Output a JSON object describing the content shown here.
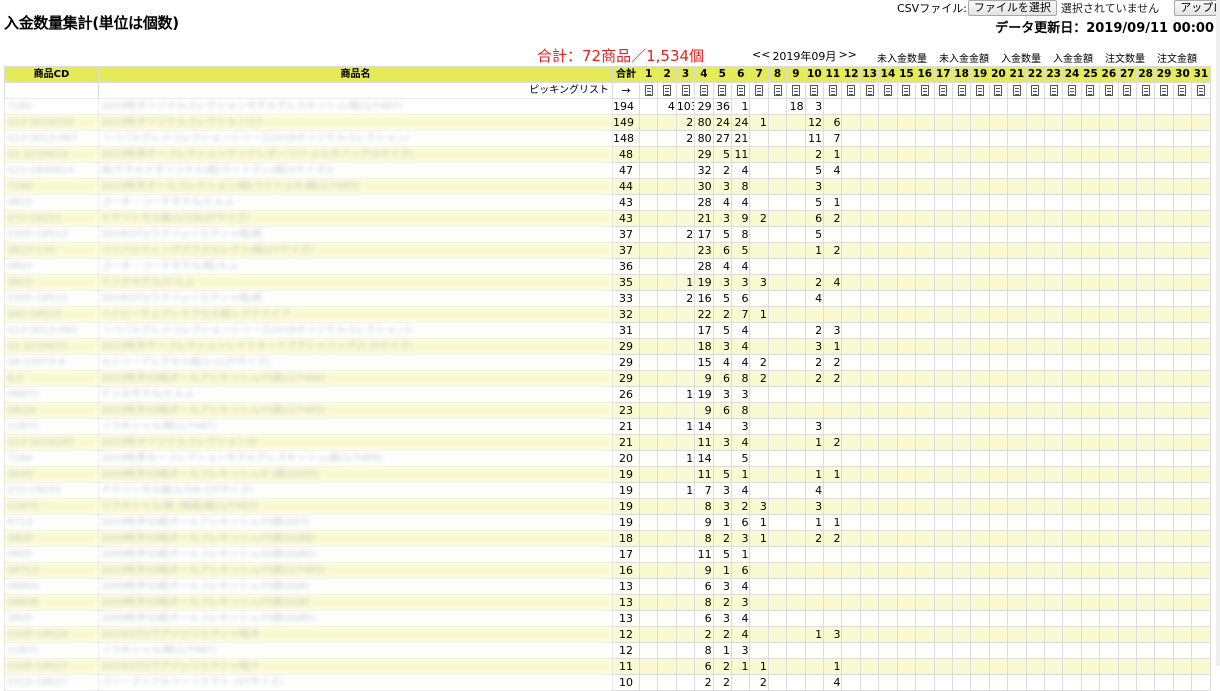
{
  "page": {
    "title": "入金数量集計(単位は個数)",
    "csv_label": "CSVファイル:",
    "choose_file_label": "ファイルを選択",
    "no_file_label": "選択されていません",
    "upload_label": "アップロード",
    "updated_label": "データ更新日：2019/09/11 00:00",
    "total_label": "合計：72商品／1,534個",
    "month_prev": "<<",
    "month_label": "2019年09月",
    "month_next": ">>",
    "view_links": [
      "未入金数量",
      "未入金金額",
      "入金数量",
      "入金金額",
      "注文数量",
      "注文金額"
    ]
  },
  "table": {
    "headers": {
      "cd": "商品CD",
      "name": "商品名",
      "sum": "合計"
    },
    "days": [
      "1",
      "2",
      "3",
      "4",
      "5",
      "6",
      "7",
      "8",
      "9",
      "10",
      "11",
      "12",
      "13",
      "14",
      "15",
      "16",
      "17",
      "18",
      "19",
      "20",
      "21",
      "22",
      "23",
      "24",
      "25",
      "26",
      "27",
      "28",
      "29",
      "30",
      "31"
    ],
    "picking_label": "ピッキングリスト",
    "picking_arrow": "→",
    "rows": [
      {
        "cd": "7182",
        "name": "2019秋オリジナルコレクションモデルグレスキッシュ/紙(1/7487)",
        "total": "194",
        "v": {
          "1": "4",
          "2": "103",
          "3": "29",
          "4": "36",
          "5": "1",
          "8": "18",
          "9": "3"
        }
      },
      {
        "cd": "S13-3014155",
        "name": "2019秋オリジナルコレクション/13",
        "total": "149",
        "v": {
          "2": "2",
          "3": "80",
          "4": "24",
          "5": "24",
          "6": "1",
          "9": "12",
          "10": "6"
        }
      },
      {
        "cd": "S13-3013-067",
        "name": "リババルグレスコレクションシリーズ2019オリジナルコレクション/",
        "total": "148",
        "v": {
          "2": "2",
          "3": "80",
          "4": "27",
          "5": "21",
          "9": "11",
          "10": "7"
        }
      },
      {
        "cd": "S1-3219414",
        "name": "2019秋季オーコレクションサックレポーツ/ショルダバッグ(Sサイズ)",
        "total": "48",
        "v": {
          "3": "29",
          "4": "5",
          "5": "11",
          "9": "2",
          "10": "1"
        }
      },
      {
        "cd": "S21-1840614",
        "name": "あ/ナチルドオリジナル/紙/ライトグレ(紙(Sサイズ))",
        "total": "47",
        "v": {
          "3": "32",
          "4": "2",
          "5": "4",
          "9": "5",
          "10": "4"
        }
      },
      {
        "cd": "7180",
        "name": "2019秋冬オールコレクション/紙(ライトふキ/紙(1/7485)",
        "total": "44",
        "v": {
          "3": "30",
          "4": "3",
          "5": "8",
          "9": "3"
        }
      },
      {
        "cd": "9815",
        "name": "ゴーホ・コーチモデル/ビルふ",
        "total": "43",
        "v": {
          "3": "28",
          "4": "4",
          "5": "4",
          "9": "5",
          "10": "1"
        }
      },
      {
        "cd": "272-19251",
        "name": "ナチリシモル紙/1/7/8(2Tサイズ)",
        "total": "43",
        "v": {
          "3": "21",
          "4": "3",
          "5": "9",
          "6": "2",
          "9": "6",
          "10": "2"
        }
      },
      {
        "cd": "2305-18513",
        "name": "2019(2T)/ラグジュリエクシャ紙/紙",
        "total": "37",
        "v": {
          "2": "2",
          "3": "17",
          "4": "5",
          "5": "8",
          "9": "5"
        }
      },
      {
        "cd": "9823-130",
        "name": "パリパルティンググラスセレクト/紙(2Tサイズ)",
        "total": "37",
        "v": {
          "3": "23",
          "4": "6",
          "5": "5",
          "9": "1",
          "10": "2"
        }
      },
      {
        "cd": "0803",
        "name": "ゴーホ・コーチモデル/紙/ルふ",
        "total": "36",
        "v": {
          "3": "28",
          "4": "4",
          "5": "4"
        }
      },
      {
        "cd": "9815",
        "name": "テジカモデル/ビルふ",
        "total": "35",
        "v": {
          "2": "1",
          "3": "19",
          "4": "3",
          "5": "3",
          "6": "3",
          "9": "2",
          "10": "4"
        }
      },
      {
        "cd": "2305-18515",
        "name": "2019(2T)/ラグジュリエクシャ紙/紙",
        "total": "33",
        "v": {
          "2": "2",
          "3": "16",
          "4": "5",
          "5": "6",
          "9": "4"
        }
      },
      {
        "cd": "S92-18515",
        "name": "ハイピーチェアレテクセル紙レグテクイア",
        "total": "32",
        "v": {
          "3": "22",
          "4": "2",
          "5": "7",
          "6": "1"
        }
      },
      {
        "cd": "S13-3013-062",
        "name": "リババルグレスコレクションシリーズ2019オリジナルコレクション2",
        "total": "31",
        "v": {
          "3": "17",
          "4": "5",
          "5": "4",
          "9": "2",
          "10": "3"
        }
      },
      {
        "cd": "S1-3219415",
        "name": "2019秋冬サーコレクションレイトキットアクシャバッグ/2 (Sサイズ)",
        "total": "29",
        "v": {
          "3": "18",
          "4": "3",
          "5": "4",
          "9": "3",
          "10": "1"
        }
      },
      {
        "cd": "S8-13573-4",
        "name": "ルシリーアレクセル紙/1-2(2Tサイズ)",
        "total": "29",
        "v": {
          "3": "15",
          "4": "4",
          "5": "4",
          "6": "2",
          "9": "2",
          "10": "2"
        }
      },
      {
        "cd": "8.8",
        "name": "2019秋冬SS紙オールアレキッシュ/7(紙(1/7486)",
        "total": "29",
        "v": {
          "3": "9",
          "4": "6",
          "5": "8",
          "6": "2",
          "9": "2",
          "10": "2"
        }
      },
      {
        "cd": "09873",
        "name": "テジカモデル/ビルふ",
        "total": "26",
        "v": {
          "2": "1",
          "3": "19",
          "4": "3",
          "5": "3"
        }
      },
      {
        "cd": "08/16",
        "name": "2019秋冬SS紙オールアレキッシュ/7(紙(1/7485)",
        "total": "23",
        "v": {
          "3": "9",
          "4": "6",
          "5": "8"
        }
      },
      {
        "cd": "11872",
        "name": "ジラキシャル/紙(1/7487)",
        "total": "21",
        "v": {
          "2": "1",
          "3": "14",
          "5": "3",
          "9": "3"
        }
      },
      {
        "cd": "S13-3014185",
        "name": "2019秋オリジナルコレクション/8",
        "total": "21",
        "v": {
          "3": "11",
          "4": "3",
          "5": "4",
          "9": "1",
          "10": "2"
        }
      },
      {
        "cd": "7184",
        "name": "2019秋季モーコレクションモデルグレスキッシュ/紙(1/7489)",
        "total": "20",
        "v": {
          "2": "1",
          "3": "14",
          "5": "5"
        }
      },
      {
        "cd": "3845",
        "name": "2009秋冬SS紙オールコレキッシュ/2 (紙(SS85)",
        "total": "19",
        "v": {
          "3": "11",
          "4": "5",
          "5": "1",
          "9": "1",
          "10": "1"
        }
      },
      {
        "cd": "272-19255",
        "name": "ナチリシモル紙/1/7/8 (2Tサイズ)",
        "total": "19",
        "v": {
          "2": "1",
          "3": "7",
          "4": "3",
          "5": "4",
          "9": "4"
        }
      },
      {
        "cd": "11875",
        "name": "ジラキシャル/紙 (紙紙/紙(1/7487)",
        "total": "19",
        "v": {
          "3": "8",
          "4": "3",
          "5": "2",
          "6": "3",
          "9": "3"
        }
      },
      {
        "cd": "8713",
        "name": "2019秋冬SS紙オールアレキッシュ/7(紙(SS7)",
        "total": "19",
        "v": {
          "3": "9",
          "4": "1",
          "5": "6",
          "6": "1",
          "9": "1",
          "10": "1"
        }
      },
      {
        "cd": "3808",
        "name": "2009秋冬SS紙オールコレキッシュ/7(紙(SS88)",
        "total": "18",
        "v": {
          "3": "8",
          "4": "2",
          "5": "3",
          "6": "1",
          "9": "2",
          "10": "2"
        }
      },
      {
        "cd": "0905",
        "name": "2009秋冬SS紙オールコレキッシュ/2(紙(SS80)",
        "total": "17",
        "v": {
          "3": "11",
          "4": "5",
          "5": "1"
        }
      },
      {
        "cd": "08713",
        "name": "2019秋冬SS紙オールアレキッシュ/7(紙(1/7485)",
        "total": "16",
        "v": {
          "3": "9",
          "4": "1",
          "5": "6"
        }
      },
      {
        "cd": "08804",
        "name": "2009秋冬SS紙オールコレキッシュ/7(紙(SS8)",
        "total": "13",
        "v": {
          "3": "6",
          "4": "3",
          "5": "4"
        }
      },
      {
        "cd": "08808",
        "name": "2009秋冬SS紙オールコレキッシュ/7(紙(SS8)",
        "total": "13",
        "v": {
          "3": "8",
          "4": "2",
          "5": "3"
        }
      },
      {
        "cd": "3805",
        "name": "2009秋冬SS紙オールコレキッシュ/7(紙(SS85)",
        "total": "13",
        "v": {
          "3": "6",
          "4": "3",
          "5": "4"
        }
      },
      {
        "cd": "2305-18518",
        "name": "2019(2T)/ラグジュリエクシャ紙/8",
        "total": "12",
        "v": {
          "3": "2",
          "4": "2",
          "5": "4",
          "9": "1",
          "10": "3"
        }
      },
      {
        "cd": "11871",
        "name": "ジラキシャル/紙(1/7487)",
        "total": "12",
        "v": {
          "3": "8",
          "4": "1",
          "5": "3"
        }
      },
      {
        "cd": "2305-18517",
        "name": "2019(2T)/ラグジュリエクシャ紙/7",
        "total": "11",
        "v": {
          "3": "6",
          "4": "2",
          "5": "1",
          "6": "1",
          "10": "1"
        }
      },
      {
        "cd": "2315-18527",
        "name": "パリーブリアルツーリテクト (2Tサイズ)",
        "total": "10",
        "v": {
          "3": "2",
          "4": "2",
          "6": "2",
          "10": "4"
        }
      }
    ]
  }
}
